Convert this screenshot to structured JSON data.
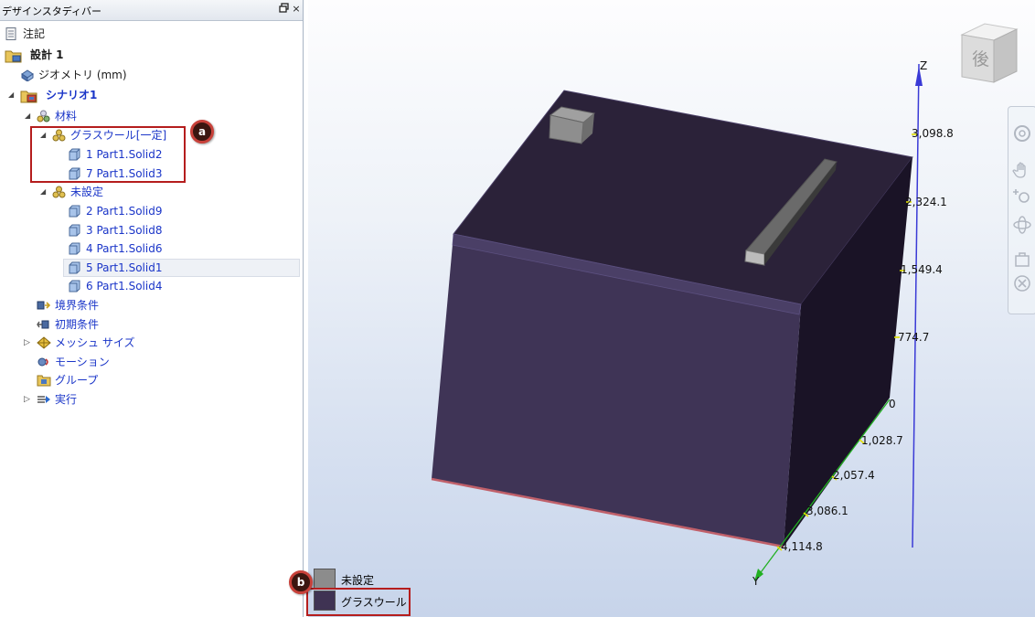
{
  "panel": {
    "title": "デザインスタディバー",
    "pin_glyph": "ð",
    "close_glyph": "×"
  },
  "tree": {
    "notes": "注記",
    "design": "設計 1",
    "geometry": "ジオメトリ (mm)",
    "scenario": "シナリオ1",
    "materials": "材料",
    "glasswool_group": "グラスウール[一定]",
    "glasswool_parts": [
      "1 Part1.Solid2",
      "7 Part1.Solid3"
    ],
    "unset_group": "未設定",
    "unset_parts": [
      "2 Part1.Solid9",
      "3 Part1.Solid8",
      "4 Part1.Solid6",
      "5 Part1.Solid1",
      "6 Part1.Solid4"
    ],
    "boundary_conditions": "境界条件",
    "initial_conditions": "初期条件",
    "mesh_size": "メッシュ サイズ",
    "motion": "モーション",
    "groups": "グループ",
    "run": "実行"
  },
  "callouts": {
    "a": "a",
    "b": "b"
  },
  "legend": [
    {
      "label": "未設定",
      "color": "#8c8c8c"
    },
    {
      "label": "グラスウール",
      "color": "#3f3353"
    }
  ],
  "viewcube": {
    "face_label": "後"
  },
  "axes": {
    "z_name": "Z",
    "y_name": "Y",
    "z_ticks": [
      "3,098.8",
      "2,324.1",
      "1,549.4",
      "774.7",
      "0"
    ],
    "y_ticks": [
      "1,028.7",
      "2,057.4",
      "3,086.1",
      "4,114.8"
    ],
    "colors": {
      "z": "#3a3ad6",
      "y": "#22b022",
      "tick": "#e0e000"
    }
  },
  "colors": {
    "callout": "#b51d1d",
    "tree_link": "#1a35c8",
    "model_front": "#3d3350",
    "model_top": "#2a2238",
    "model_side": "#1a1326"
  }
}
